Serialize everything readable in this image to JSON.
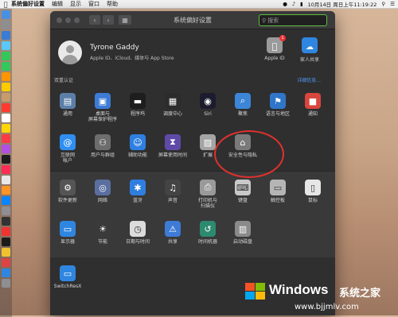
{
  "menubar": {
    "app_name": "系统偏好设置",
    "menus": [
      "编辑",
      "显示",
      "窗口",
      "帮助"
    ],
    "clock": "10月14日 周日上午11:19:22"
  },
  "window": {
    "title": "系统偏好设置",
    "search": {
      "value": "",
      "placeholder": "搜索"
    }
  },
  "account": {
    "name": "Tyrone Gaddy",
    "subtitle": "Apple ID、iCloud、媒体与 App Store",
    "apple_id_label": "Apple ID",
    "apple_id_badge": "1",
    "family_label": "家人共享",
    "twofa_label": "双重认证",
    "details_label": "详细信息..."
  },
  "row1": [
    {
      "label": "通用",
      "icon": "general-icon",
      "color": "#5b7fa8"
    },
    {
      "label": "桌面与\n屏幕保护程序",
      "icon": "desktop-icon",
      "color": "#3d7bd6"
    },
    {
      "label": "程序坞",
      "icon": "dock-icon",
      "color": "#1e1e1e"
    },
    {
      "label": "调度中心",
      "icon": "mission-control-icon",
      "color": "#2c2c2c"
    },
    {
      "label": "Siri",
      "icon": "siri-icon",
      "color": "#1c1c2e"
    },
    {
      "label": "聚焦",
      "icon": "spotlight-icon",
      "color": "#3c86d8"
    },
    {
      "label": "语言与地区",
      "icon": "language-icon",
      "color": "#2f76c9"
    },
    {
      "label": "通知",
      "icon": "notifications-icon",
      "color": "#d9463d"
    }
  ],
  "row2": [
    {
      "label": "互联网\n帐户",
      "icon": "internet-accounts-icon",
      "color": "#2f8ef0"
    },
    {
      "label": "用户与群组",
      "icon": "users-groups-icon",
      "color": "#6d6d6d"
    },
    {
      "label": "辅助功能",
      "icon": "accessibility-icon",
      "color": "#2f7fe0"
    },
    {
      "label": "屏幕使用时间",
      "icon": "screen-time-icon",
      "color": "#5f4aa8"
    },
    {
      "label": "扩展",
      "icon": "extensions-icon",
      "color": "#a4a4a4"
    },
    {
      "label": "安全性与隐私",
      "icon": "security-privacy-icon",
      "color": "#7a7a7a"
    }
  ],
  "row3": [
    {
      "label": "软件更新",
      "icon": "software-update-icon",
      "color": "#555555"
    },
    {
      "label": "网络",
      "icon": "network-icon",
      "color": "#5a6fa0"
    },
    {
      "label": "蓝牙",
      "icon": "bluetooth-icon",
      "color": "#2f7fe0"
    },
    {
      "label": "声音",
      "icon": "sound-icon",
      "color": "#444444"
    },
    {
      "label": "打印机与\n扫描仪",
      "icon": "printers-icon",
      "color": "#9a9a9a"
    },
    {
      "label": "键盘",
      "icon": "keyboard-icon",
      "color": "#c9c9c9"
    },
    {
      "label": "触控板",
      "icon": "trackpad-icon",
      "color": "#b5b5b5"
    },
    {
      "label": "鼠标",
      "icon": "mouse-icon",
      "color": "#e6e6e6"
    }
  ],
  "row4": [
    {
      "label": "显示器",
      "icon": "displays-icon",
      "color": "#2f86e0"
    },
    {
      "label": "节能",
      "icon": "energy-saver-icon",
      "color": "#3a3a3a"
    },
    {
      "label": "日期与时间",
      "icon": "date-time-icon",
      "color": "#dcdcdc"
    },
    {
      "label": "共享",
      "icon": "sharing-icon",
      "color": "#3d7bd6"
    },
    {
      "label": "时间机器",
      "icon": "time-machine-icon",
      "color": "#2c8a6e"
    },
    {
      "label": "启动磁盘",
      "icon": "startup-disk-icon",
      "color": "#8a8a8a"
    }
  ],
  "row5": [
    {
      "label": "SwitchResX",
      "icon": "switchresx-icon",
      "color": "#2f86e0"
    }
  ],
  "watermark": {
    "brand": "Windows",
    "cn": "系统之家",
    "url": "www.bjjmlv.com"
  }
}
